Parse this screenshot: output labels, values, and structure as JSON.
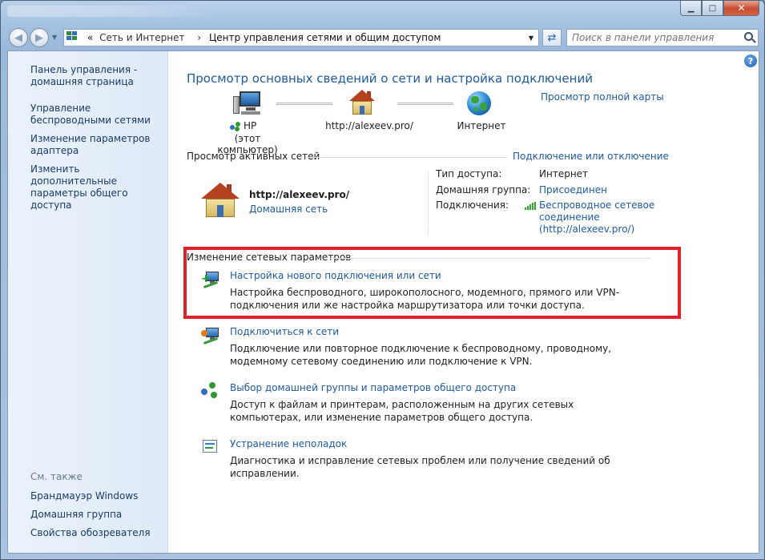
{
  "window": {
    "minimize_glyph": "▁",
    "maximize_glyph": "□",
    "close_glyph": "✕"
  },
  "address": {
    "prefix": "«",
    "crumbs": [
      "Сеть и Интернет",
      "Центр управления сетями и общим доступом"
    ],
    "separator": "›"
  },
  "search": {
    "placeholder": "Поиск в панели управления"
  },
  "sidebar": {
    "home_label": "Панель управления - домашняя страница",
    "links": [
      "Управление беспроводными сетями",
      "Изменение параметров адаптера",
      "Изменить дополнительные параметры общего доступа"
    ],
    "see_also_heading": "См. также",
    "see_also": [
      "Брандмауэр Windows",
      "Домашняя группа",
      "Свойства обозревателя"
    ]
  },
  "main": {
    "title": "Просмотр основных сведений о сети и настройка подключений",
    "full_map_link": "Просмотр полной карты",
    "map": {
      "computer_name": "HP",
      "computer_caption": "(этот компьютер)",
      "network_name": "http://alexeev.pro/",
      "internet_label": "Интернет"
    },
    "active_networks": {
      "heading": "Просмотр активных сетей",
      "connect_link": "Подключение или отключение",
      "network_name": "http://alexeev.pro/",
      "network_type": "Домашняя сеть",
      "access_type_label": "Тип доступа:",
      "access_type_value": "Интернет",
      "homegroup_label": "Домашняя группа:",
      "homegroup_value": "Присоединен",
      "connections_label": "Подключения:",
      "connection_value": "Беспроводное сетевое соединение (http://alexeev.pro/)"
    },
    "change_settings": {
      "heading": "Изменение сетевых параметров",
      "tasks": [
        {
          "link": "Настройка нового подключения или сети",
          "desc": "Настройка беспроводного, широкополосного, модемного, прямого или VPN-подключения или же настройка маршрутизатора или точки доступа."
        },
        {
          "link": "Подключиться к сети",
          "desc": "Подключение или повторное подключение к беспроводному, проводному, модемному сетевому соединению или подключение к VPN."
        },
        {
          "link": "Выбор домашней группы и параметров общего доступа",
          "desc": "Доступ к файлам и принтерам, расположенным на других сетевых компьютерах, или изменение параметров общего доступа."
        },
        {
          "link": "Устранение неполадок",
          "desc": "Диагностика и исправление сетевых проблем или получение сведений об исправлении."
        }
      ]
    },
    "help_glyph": "?"
  },
  "colors": {
    "link": "#1d5aa2",
    "highlight_box": "#e0202a"
  }
}
